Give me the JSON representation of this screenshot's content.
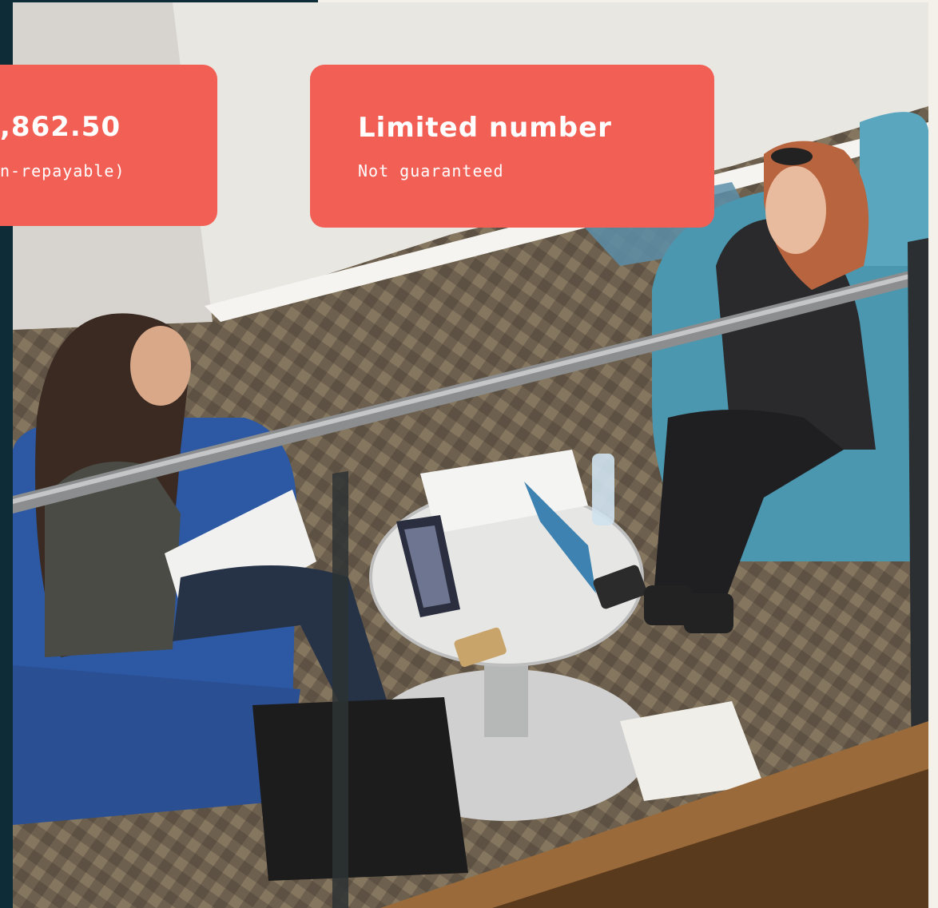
{
  "cards": {
    "amount": {
      "title": ",862.50",
      "subtitle": "n-repayable)"
    },
    "limited": {
      "title": "Limited number",
      "subtitle": "Not guaranteed"
    }
  },
  "colors": {
    "card_background": "#f25f55",
    "card_text": "#ffffff",
    "left_strip": "#0e2c38",
    "page_background": "#f3f1ea"
  },
  "image": {
    "name": "two-women-talking-in-lounge-photo"
  }
}
